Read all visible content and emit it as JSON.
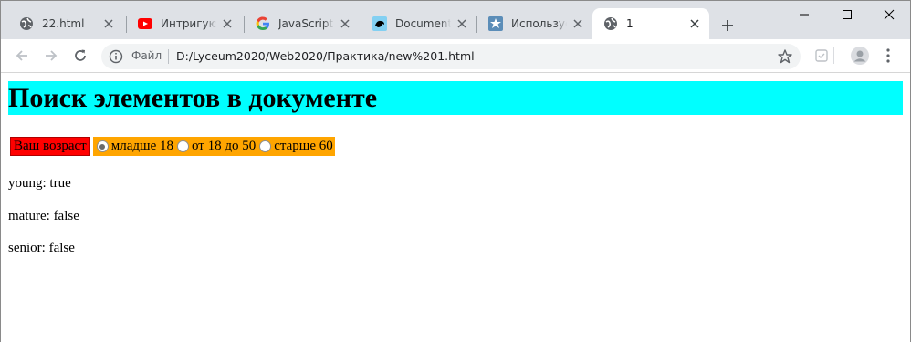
{
  "tabs": [
    {
      "title": "22.html",
      "icon": "globe-icon"
    },
    {
      "title": "Интригующ",
      "icon": "youtube-icon"
    },
    {
      "title": "JavaScript d",
      "icon": "google-icon"
    },
    {
      "title": "Document.c",
      "icon": "mdn-icon"
    },
    {
      "title": "Использует",
      "icon": "puzzle-icon"
    },
    {
      "title": "1",
      "icon": "globe-icon"
    }
  ],
  "omnibox": {
    "scheme_label": "Файл",
    "url": "D:/Lyceum2020/Web2020/Практика/new%201.html"
  },
  "page": {
    "heading": "Поиск элементов в документе",
    "age_label": "Ваш возраст",
    "options": [
      {
        "label": "младше 18",
        "checked": true
      },
      {
        "label": "от 18 до 50",
        "checked": false
      },
      {
        "label": "старше 60",
        "checked": false
      }
    ],
    "results": [
      "young: true",
      "mature: false",
      "senior: false"
    ]
  },
  "colors": {
    "heading_bg": "#00ffff",
    "label_bg": "#ff0000",
    "radio_group_bg": "#ffa500",
    "tabstrip_bg": "#dee1e6"
  }
}
